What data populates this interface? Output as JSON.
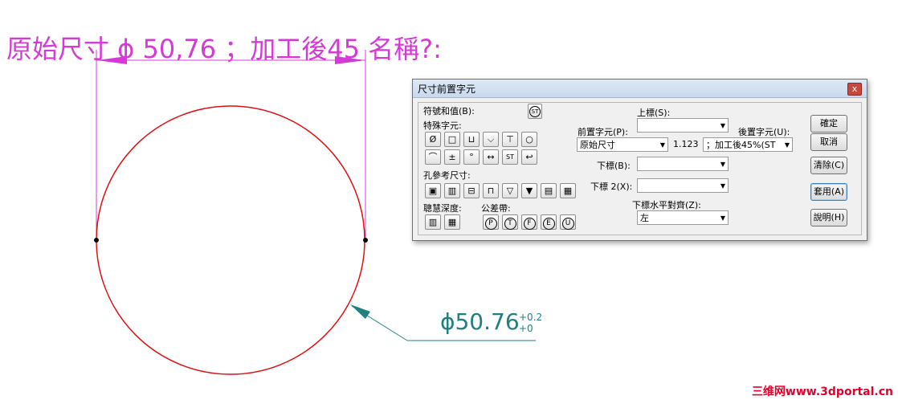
{
  "drawing": {
    "top_label": "原始尺寸 ϕ 50,76 ；加工後45 名稱?:",
    "dim_value": "ϕ50.76",
    "tol_upper": "+0.2",
    "tol_lower": "+0",
    "watermark": "三维网www.3dportal.cn",
    "colors": {
      "magenta": "#d43bd6",
      "circle": "#e01010",
      "teal": "#208080"
    }
  },
  "dialog": {
    "title": "尺寸前置字元",
    "close_label": "x",
    "symbols_label": "符號和值(B):",
    "st_button": "ST",
    "special_label": "特殊字元:",
    "special_row1": [
      "Ø",
      "□",
      "⊔",
      "⌵",
      "⊤",
      "○"
    ],
    "special_row2": [
      "⌒",
      "±",
      "°",
      "↔",
      "ST",
      "↩"
    ],
    "hole_label": "孔參考尺寸:",
    "smart_label": "聰慧深度:",
    "tolerance_label": "公差帶:",
    "tolerance_buttons": [
      "P",
      "T",
      "F",
      "E",
      "U"
    ],
    "superscript_label": "上標(S):",
    "prefix_label": "前置字元(P):",
    "prefix_value": "原始尺寸",
    "value_text": "1.123",
    "suffix_label": "後置字元(U):",
    "suffix_value": "；加工後45%(ST",
    "subscript_label": "下標(B):",
    "subscript2_label": "下標 2(X):",
    "halign_label": "下標水平對齊(Z):",
    "halign_value": "左",
    "buttons": {
      "ok": "確定",
      "cancel": "取消",
      "clear": "清除(C)",
      "apply": "套用(A)",
      "help": "說明(H)"
    }
  }
}
